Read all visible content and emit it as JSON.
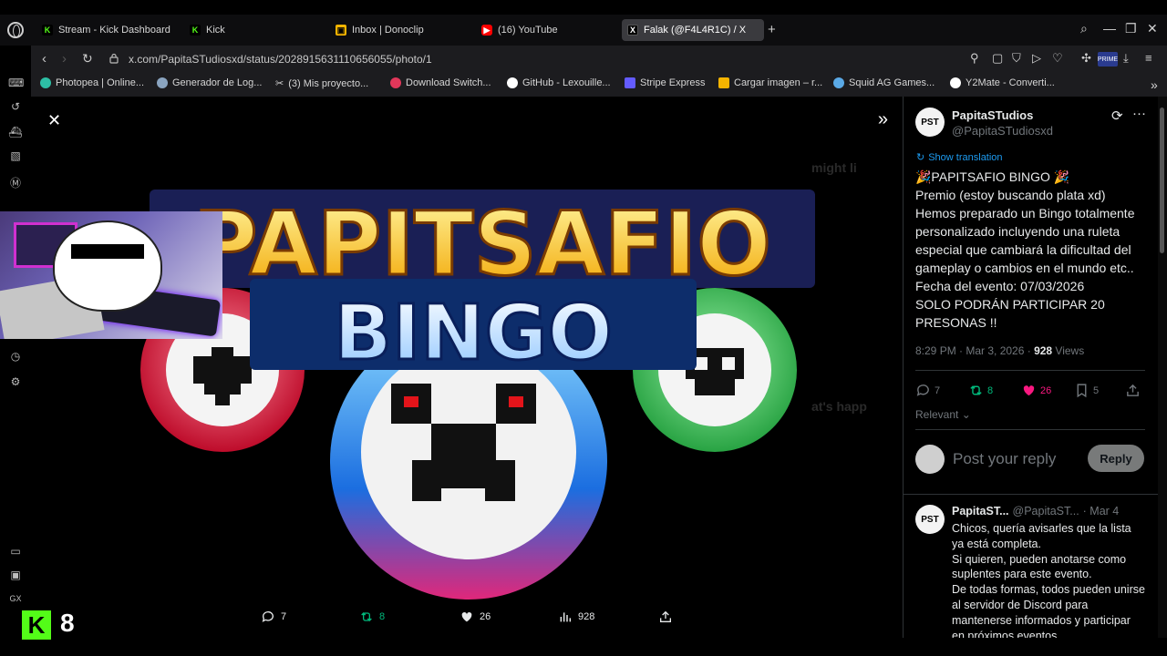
{
  "browser": {
    "tabs": [
      {
        "label": "Stream - Kick Dashboard",
        "icon": "kick-icon"
      },
      {
        "label": "Kick",
        "icon": "kick-icon"
      },
      {
        "label": "Inbox | Donoclip",
        "icon": "donoclip-icon"
      },
      {
        "label": "(16) YouTube",
        "icon": "youtube-icon"
      },
      {
        "label": "Falak (@F4L4R1C) / X",
        "icon": "x-icon"
      }
    ],
    "url": "x.com/PapitaSTudiosxd/status/2028915631110656055/photo/1",
    "bookmarks": [
      {
        "label": "Photopea | Online...",
        "color": "#2dbfa5"
      },
      {
        "label": "Generador de Log...",
        "color": "#8aa4c0"
      },
      {
        "label": "(3)  Mis proyecto...",
        "color": "#ffffff"
      },
      {
        "label": "Download Switch...",
        "color": "#e2375a"
      },
      {
        "label": "GitHub - Lexouille...",
        "color": "#ffffff"
      },
      {
        "label": "Stripe Express",
        "color": "#635bff"
      },
      {
        "label": "Cargar imagen – r...",
        "color": "#f5b400"
      },
      {
        "label": "Squid AG Games...",
        "color": "#5aa9e6"
      },
      {
        "label": "Y2Mate - Converti...",
        "color": "#ffffff"
      }
    ]
  },
  "artwork": {
    "title_top": "PAPITSAFIO",
    "title_bottom": "BINGO"
  },
  "viewer_actions": {
    "replies": "7",
    "reposts": "8",
    "likes": "26",
    "views": "928"
  },
  "kick_overlay": {
    "badge": "K",
    "count": "8"
  },
  "tweet": {
    "name": "PapitaSTudios",
    "handle": "@PapitaSTudiosxd",
    "avatar_text": "PST",
    "show_translation": "Show translation",
    "text": "🎉PAPITSAFIO BINGO 🎉\nPremio (estoy buscando plata xd)\nHemos preparado un Bingo totalmente personalizado incluyendo una ruleta especial que cambiará la dificultad del gameplay o cambios en el mundo etc..\nFecha del evento: 07/03/2026\nSOLO PODRÁN PARTICIPAR 20 PRESONAS !!",
    "time": "8:29 PM · Mar 3, 2026 · ",
    "views_count": "928",
    "views_label": " Views",
    "replies": "7",
    "reposts": "8",
    "likes": "26",
    "bookmarks": "5",
    "sort_label": "Relevant"
  },
  "reply_box": {
    "placeholder": "Post your reply",
    "button": "Reply"
  },
  "reply": {
    "name": "PapitaST...",
    "handle": "@PapitaST...",
    "date": "· Mar 4",
    "text": "Chicos, quería avisarles que la lista ya está completa.\nSi quieren, pueden anotarse como suplentes para este evento.\nDe todas formas, todos pueden unirse al servidor de Discord para mantenerse informados y participar en próximos eventos."
  },
  "colors": {
    "accent": "#1d9bf0",
    "like": "#f91880",
    "repost": "#00ba7c",
    "kick": "#53fc18"
  }
}
